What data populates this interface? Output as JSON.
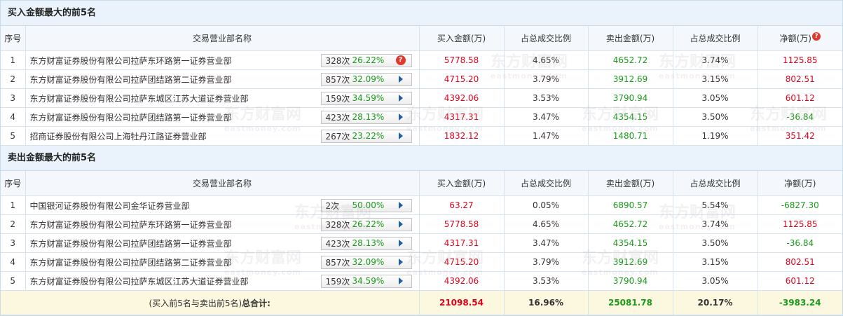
{
  "buy_section": {
    "title": "买入金额最大的前5名",
    "headers": [
      "序号",
      "交易营业部名称",
      "买入金额(万)",
      "占总成交比例",
      "卖出金额(万)",
      "占总成交比例",
      "净额(万)"
    ],
    "rows": [
      {
        "idx": "1",
        "name": "东方财富证券股份有限公司拉萨东环路第一证券营业部",
        "count": "328次",
        "pct": "26.22%",
        "icon": "question-icon",
        "buy": "5778.58",
        "buy_ratio": "4.65%",
        "sell": "4652.72",
        "sell_ratio": "3.74%",
        "net": "1125.85",
        "net_color": "red"
      },
      {
        "idx": "2",
        "name": "东方财富证券股份有限公司拉萨团结路第二证券营业部",
        "count": "857次",
        "pct": "32.09%",
        "icon": "arrow-right-icon",
        "buy": "4715.20",
        "buy_ratio": "3.79%",
        "sell": "3912.69",
        "sell_ratio": "3.15%",
        "net": "802.51",
        "net_color": "red"
      },
      {
        "idx": "3",
        "name": "东方财富证券股份有限公司拉萨东城区江苏大道证券营业部",
        "count": "159次",
        "pct": "34.59%",
        "icon": "arrow-right-icon",
        "buy": "4392.06",
        "buy_ratio": "3.53%",
        "sell": "3790.94",
        "sell_ratio": "3.05%",
        "net": "601.12",
        "net_color": "red"
      },
      {
        "idx": "4",
        "name": "东方财富证券股份有限公司拉萨团结路第一证券营业部",
        "count": "423次",
        "pct": "28.13%",
        "icon": "arrow-right-icon",
        "buy": "4317.31",
        "buy_ratio": "3.47%",
        "sell": "4354.15",
        "sell_ratio": "3.50%",
        "net": "-36.84",
        "net_color": "green"
      },
      {
        "idx": "5",
        "name": "招商证券股份有限公司上海牡丹江路证券营业部",
        "count": "267次",
        "pct": "23.22%",
        "icon": "arrow-right-icon",
        "buy": "1832.12",
        "buy_ratio": "1.47%",
        "sell": "1480.71",
        "sell_ratio": "1.19%",
        "net": "351.42",
        "net_color": "red"
      }
    ]
  },
  "sell_section": {
    "title": "卖出金额最大的前5名",
    "headers": [
      "序号",
      "交易营业部名称",
      "买入金额(万)",
      "占总成交比例",
      "卖出金额(万)",
      "占总成交比例",
      "净额(万)"
    ],
    "rows": [
      {
        "idx": "1",
        "name": "中国银河证券股份有限公司金华证券营业部",
        "count": "2次",
        "pct": "50.00%",
        "icon": "arrow-right-icon",
        "buy": "63.27",
        "buy_ratio": "0.05%",
        "sell": "6890.57",
        "sell_ratio": "5.54%",
        "net": "-6827.30",
        "net_color": "green"
      },
      {
        "idx": "2",
        "name": "东方财富证券股份有限公司拉萨东环路第一证券营业部",
        "count": "328次",
        "pct": "26.22%",
        "icon": "arrow-right-icon",
        "buy": "5778.58",
        "buy_ratio": "4.65%",
        "sell": "4652.72",
        "sell_ratio": "3.74%",
        "net": "1125.85",
        "net_color": "red"
      },
      {
        "idx": "3",
        "name": "东方财富证券股份有限公司拉萨团结路第一证券营业部",
        "count": "423次",
        "pct": "28.13%",
        "icon": "arrow-right-icon",
        "buy": "4317.31",
        "buy_ratio": "3.47%",
        "sell": "4354.15",
        "sell_ratio": "3.50%",
        "net": "-36.84",
        "net_color": "green"
      },
      {
        "idx": "4",
        "name": "东方财富证券股份有限公司拉萨团结路第二证券营业部",
        "count": "857次",
        "pct": "32.09%",
        "icon": "arrow-right-icon",
        "buy": "4715.20",
        "buy_ratio": "3.79%",
        "sell": "3912.69",
        "sell_ratio": "3.15%",
        "net": "802.51",
        "net_color": "red"
      },
      {
        "idx": "5",
        "name": "东方财富证券股份有限公司拉萨东城区江苏大道证券营业部",
        "count": "159次",
        "pct": "34.59%",
        "icon": "arrow-right-icon",
        "buy": "4392.06",
        "buy_ratio": "3.53%",
        "sell": "3790.94",
        "sell_ratio": "3.05%",
        "net": "601.12",
        "net_color": "red"
      }
    ],
    "total": {
      "label_prefix": "(买入前5名与卖出前5名)",
      "label_bold": "总合计:",
      "buy": "21098.54",
      "buy_ratio": "16.96%",
      "sell": "25081.78",
      "sell_ratio": "20.17%",
      "net": "-3983.24",
      "net_color": "green"
    }
  },
  "watermark": {
    "cn": "东方财富网",
    "en": "eastmoney.com"
  },
  "colors": {
    "positive": "#e0001b",
    "negative": "#1a9a1a",
    "header_bg": "#eaf3fb",
    "total_bg": "#fcf8e0",
    "link_arrow": "#1f5fa8"
  }
}
